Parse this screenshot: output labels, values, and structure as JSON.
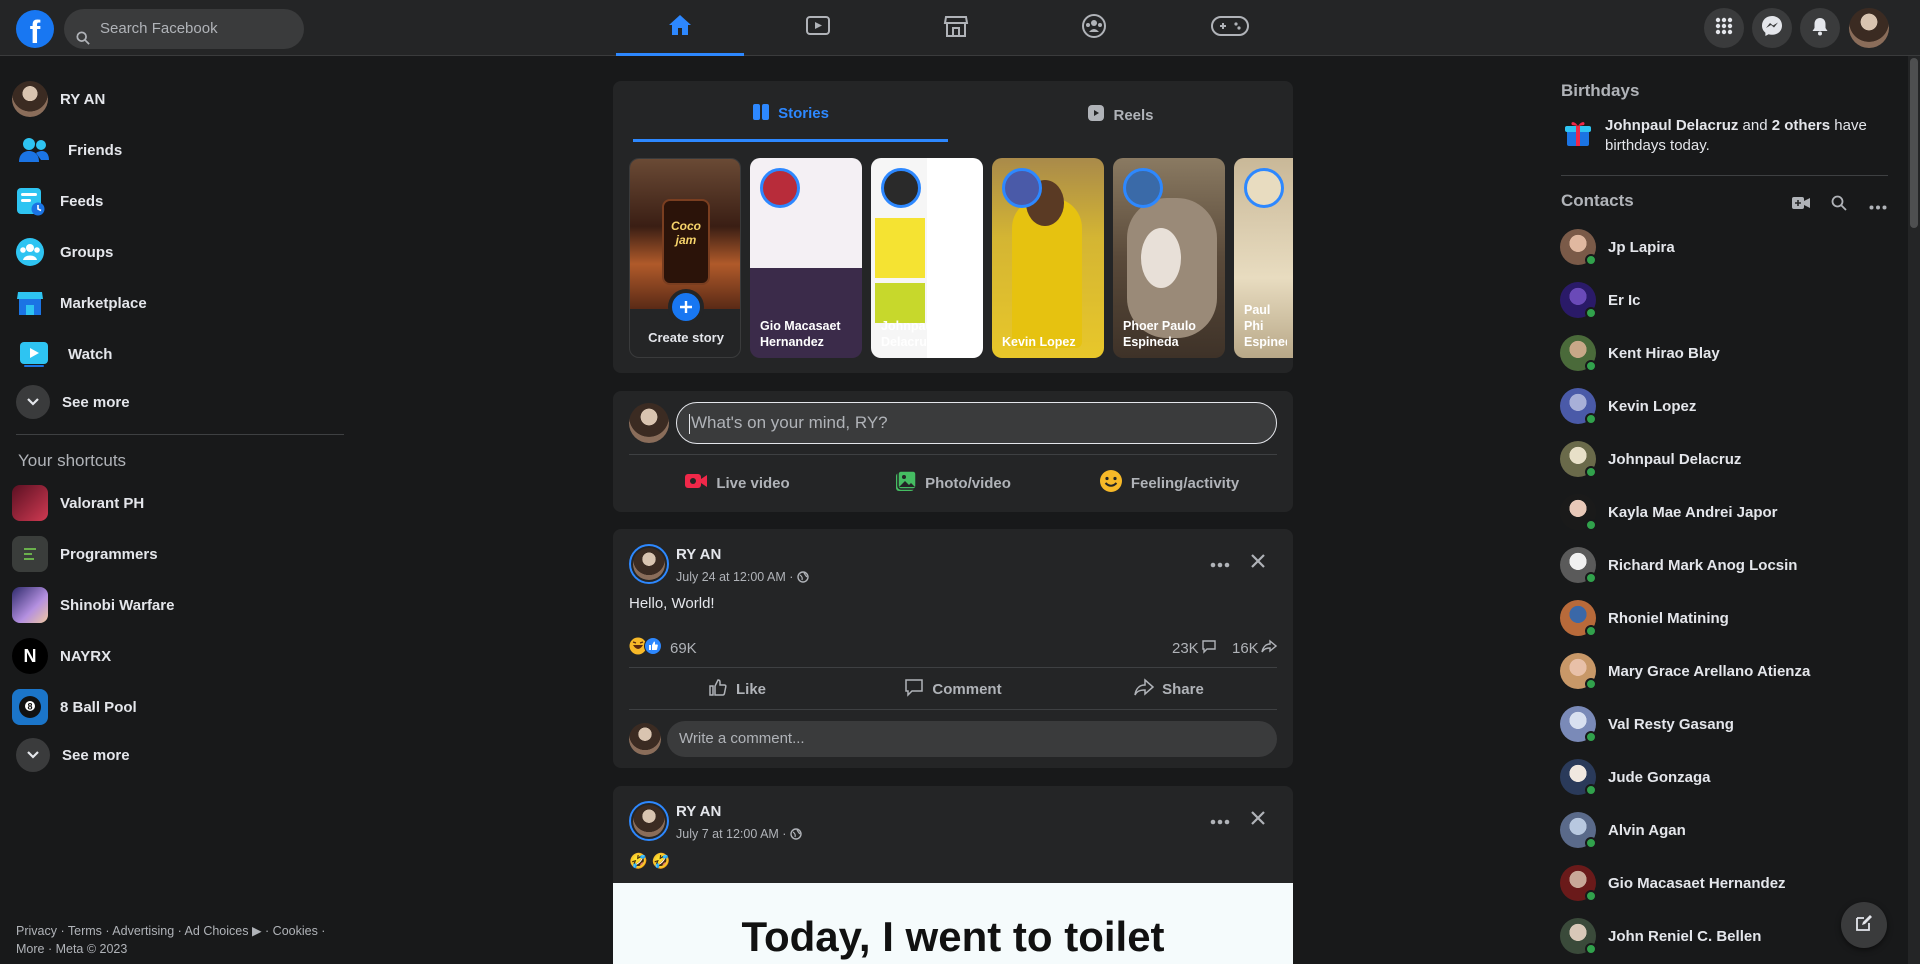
{
  "topbar": {
    "logo": "f",
    "search_placeholder": "Search Facebook",
    "nav_tabs": [
      "home-icon",
      "watch-icon",
      "marketplace-icon",
      "groups-icon",
      "gaming-icon"
    ],
    "active_tab": "home-icon"
  },
  "left_sidebar": {
    "profile_name": "RY AN",
    "items": [
      {
        "label": "Friends",
        "icon": "friends-icon"
      },
      {
        "label": "Feeds",
        "icon": "feeds-icon"
      },
      {
        "label": "Groups",
        "icon": "groups-icon"
      },
      {
        "label": "Marketplace",
        "icon": "marketplace-icon"
      },
      {
        "label": "Watch",
        "icon": "watch-icon"
      }
    ],
    "see_more": "See more",
    "shortcuts_title": "Your shortcuts",
    "shortcuts": [
      {
        "label": "Valorant PH",
        "color": "#b3243b"
      },
      {
        "label": "Programmers",
        "color": "#3a4a3a"
      },
      {
        "label": "Shinobi Warfare",
        "color": "#7a5ab8"
      },
      {
        "label": "NAYRX",
        "color": "#111111"
      },
      {
        "label": "8 Ball Pool",
        "color": "#1b75c9"
      }
    ],
    "shortcuts_see_more": "See more",
    "footer_line1": "Privacy · Terms · Advertising · Ad Choices ▶ · Cookies ·",
    "footer_line2": "More · Meta © 2023"
  },
  "stories": {
    "tab_stories": "Stories",
    "tab_reels": "Reels",
    "create_label": "Create story",
    "create_text": "Coco jam",
    "items": [
      {
        "name": "Gio Macasaet Hernandez",
        "bg": "#e9e4ea"
      },
      {
        "name": "Johnpaul Delacruz",
        "bg": "#f2f2f2"
      },
      {
        "name": "Kevin Lopez",
        "bg": "#c9a227"
      },
      {
        "name": "Phoer Paulo Espineda",
        "bg": "#6b5a45"
      },
      {
        "name": "Paul Phi Espined",
        "bg": "#d9c7a8"
      }
    ]
  },
  "composer": {
    "placeholder": "What's on your mind, RY?",
    "live": "Live video",
    "photo": "Photo/video",
    "feeling": "Feeling/activity"
  },
  "posts": [
    {
      "author": "RY AN",
      "time": "July 24 at 12:00 AM ·",
      "text": "Hello, World!",
      "reactions": "69K",
      "comments": "23K",
      "shares": "16K",
      "like": "Like",
      "comment": "Comment",
      "share": "Share",
      "comment_placeholder": "Write a comment..."
    },
    {
      "author": "RY AN",
      "time": "July 7 at 12:00 AM ·",
      "text": "🤣 🤣",
      "image_text": "Today, I went to toilet"
    }
  ],
  "right_sidebar": {
    "birthdays_title": "Birthdays",
    "birthday_name": "Johnpaul Delacruz",
    "birthday_and": " and ",
    "birthday_others": "2 others",
    "birthday_rest": " have birthdays today.",
    "contacts_title": "Contacts",
    "contacts": [
      "Jp Lapira",
      "Er Ic",
      "Kent Hirao Blay",
      "Kevin Lopez",
      "Johnpaul Delacruz",
      "Kayla Mae Andrei Japor",
      "Richard Mark Anog Locsin",
      "Rhoniel Matining",
      "Mary Grace Arellano Atienza",
      "Val Resty Gasang",
      "Jude Gonzaga",
      "Alvin Agan",
      "Gio Macasaet Hernandez",
      "John Reniel C. Bellen"
    ]
  },
  "colors": {
    "accent": "#2d88ff",
    "brand": "#1877f2",
    "online": "#31a24c",
    "live": "#f02849",
    "photo": "#45bd62",
    "feeling": "#f7b928"
  }
}
